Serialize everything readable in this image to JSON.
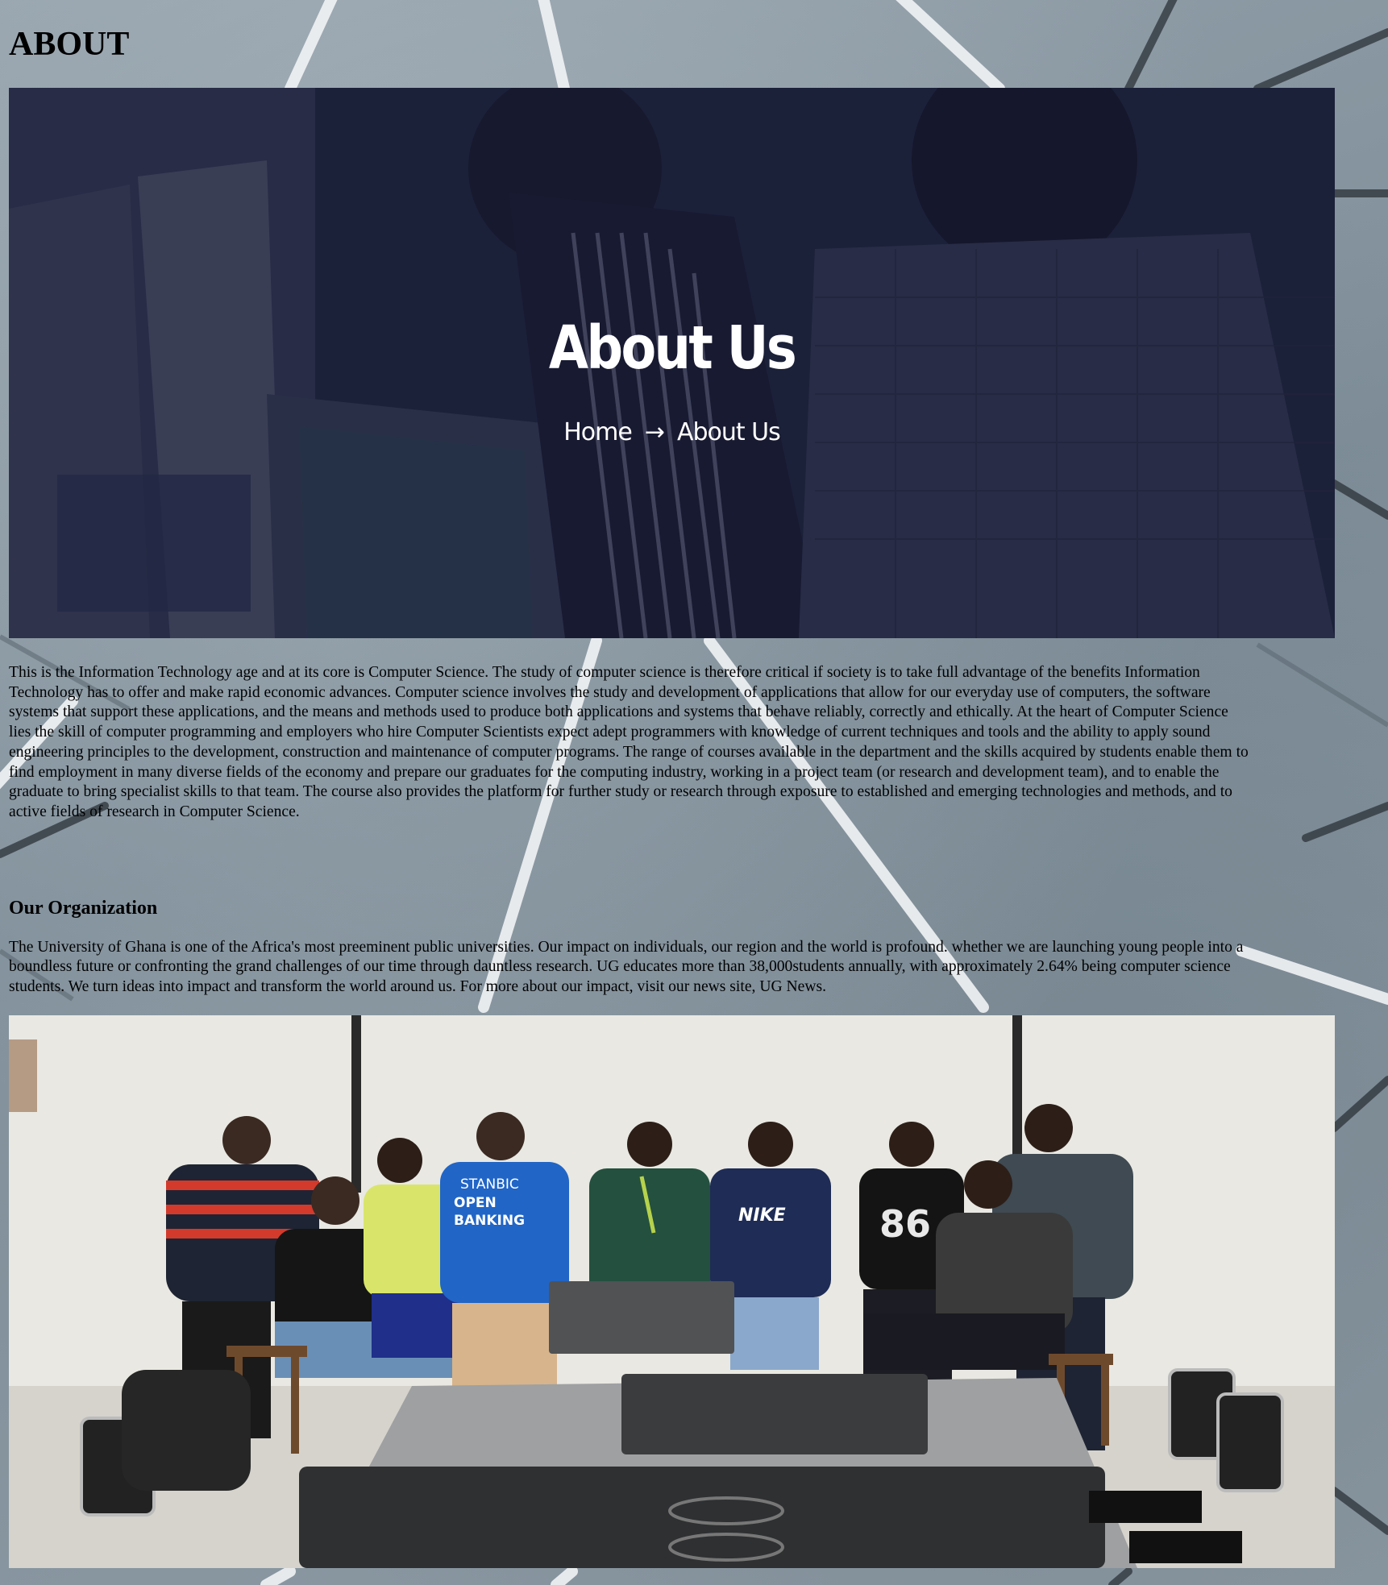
{
  "page": {
    "heading": "ABOUT"
  },
  "hero": {
    "title": "About Us",
    "breadcrumb": {
      "home": "Home",
      "separator": "→",
      "current": "About Us"
    }
  },
  "about": {
    "lines": [
      "This is the Information Technology age and at its core is Computer Science. The study of computer science is therefore critical if society is to take full advantage of the benefits Information",
      "Technology has to offer and make rapid economic advances. Computer science involves the study and development of applications that allow for our everyday use of computers, the software",
      "systems that support these applications, and the means and methods used to produce both applications and systems that behave reliably, correctly and ethically. At the heart of Computer Science",
      "lies the skill of computer programming and employers who hire Computer Scientists expect adept programmers with knowledge of current techniques and tools and the ability to apply sound",
      "engineering principles to the development, construction and maintenance of computer programs. The range of courses available in the department and the skills acquired by students enable them to",
      "find employment in many diverse fields of the economy and prepare our graduates for the computing industry, working in a project team (or research and development team), and to enable the",
      "graduate to bring specialist skills to that team. The course also provides the platform for further study or research through exposure to established and emerging technologies and methods, and to",
      "active fields of research in Computer Science."
    ]
  },
  "organization": {
    "heading": "Our Organization",
    "lines": [
      "The University of Ghana is one of the Africa's most preeminent public universities. Our impact on individuals, our region and the world is profound. whether we are launching young people into a",
      "boundless future or confronting the grand challenges of our time through dauntless research. UG educates more than 38,000students annually, with approximately 2.64% being computer science",
      "students. We turn ideas into impact and transform the world around us. For more about our impact, visit our news site, UG News."
    ]
  },
  "photo": {
    "shirt_texts": [
      "STANBIC",
      "OPEN",
      "BANKING",
      "NIKE",
      "86"
    ]
  },
  "colors": {
    "background": "#8896a1",
    "hero_overlay": "#141630",
    "text": "#000000"
  }
}
